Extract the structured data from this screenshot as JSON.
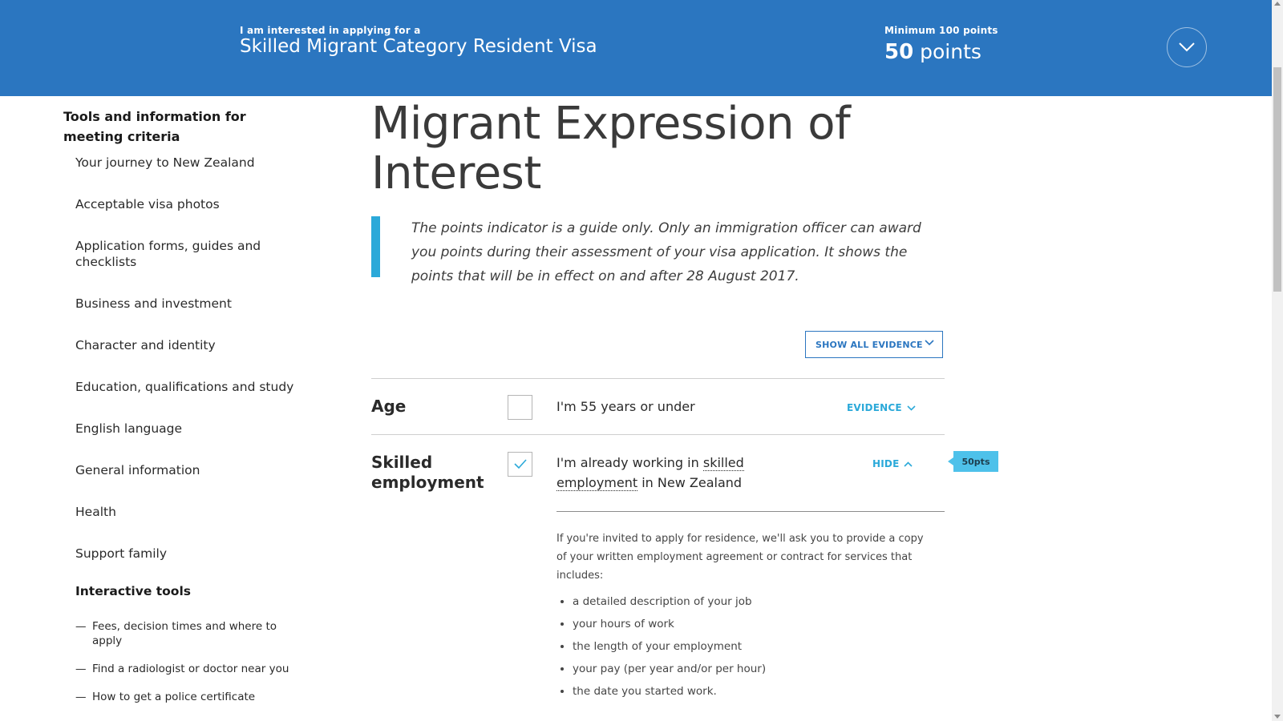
{
  "banner": {
    "visa_label": "I am interested in applying for a",
    "visa_name": "Skilled Migrant Category Resident Visa",
    "min_label": "Minimum 100 points",
    "points_value": "50",
    "points_unit": "points"
  },
  "sidebar": {
    "heading": "Tools and information for meeting criteria",
    "items": [
      {
        "label": "Your journey to New Zealand"
      },
      {
        "label": "Acceptable visa photos"
      },
      {
        "label": "Application forms, guides and checklists"
      },
      {
        "label": "Business and investment"
      },
      {
        "label": "Character and identity"
      },
      {
        "label": "Education, qualifications and study"
      },
      {
        "label": "English language"
      },
      {
        "label": "General information"
      },
      {
        "label": "Health"
      },
      {
        "label": "Support family"
      }
    ],
    "subheading": "Interactive tools",
    "tools": [
      {
        "label": "Fees, decision times and where to apply"
      },
      {
        "label": "Find a radiologist or doctor near you"
      },
      {
        "label": "How to get a police certificate"
      }
    ]
  },
  "main": {
    "title": "Migrant Expression of Interest",
    "notice": "The points indicator is a guide only. Only an immigration officer can award you points during their assessment of your visa application. It shows the points that will be in effect on and after 28 August 2017.",
    "show_all_label": "SHOW ALL EVIDENCE",
    "rows": [
      {
        "criterion": "Age",
        "statement": "I'm 55 years or under",
        "checked": false,
        "toggle_label": "EVIDENCE"
      },
      {
        "criterion": "Skilled employment",
        "statement_pre": "I'm already working in",
        "statement_term": "skilled employment",
        "statement_post": "in New Zealand",
        "checked": true,
        "toggle_label": "HIDE",
        "points_tag": "50pts",
        "evidence_text": "If you're invited to apply for residence, we'll ask you to provide a copy of your written employment agreement or contract for services that includes:",
        "evidence_items": [
          "a detailed description of your job",
          "your hours of work",
          "the length of your employment",
          "your pay (per year and/or per hour)",
          "the date you started work."
        ]
      }
    ]
  },
  "colors": {
    "banner": "#2b76c0",
    "accent": "#2ba9d9",
    "points_tag": "#4ec1ea"
  }
}
